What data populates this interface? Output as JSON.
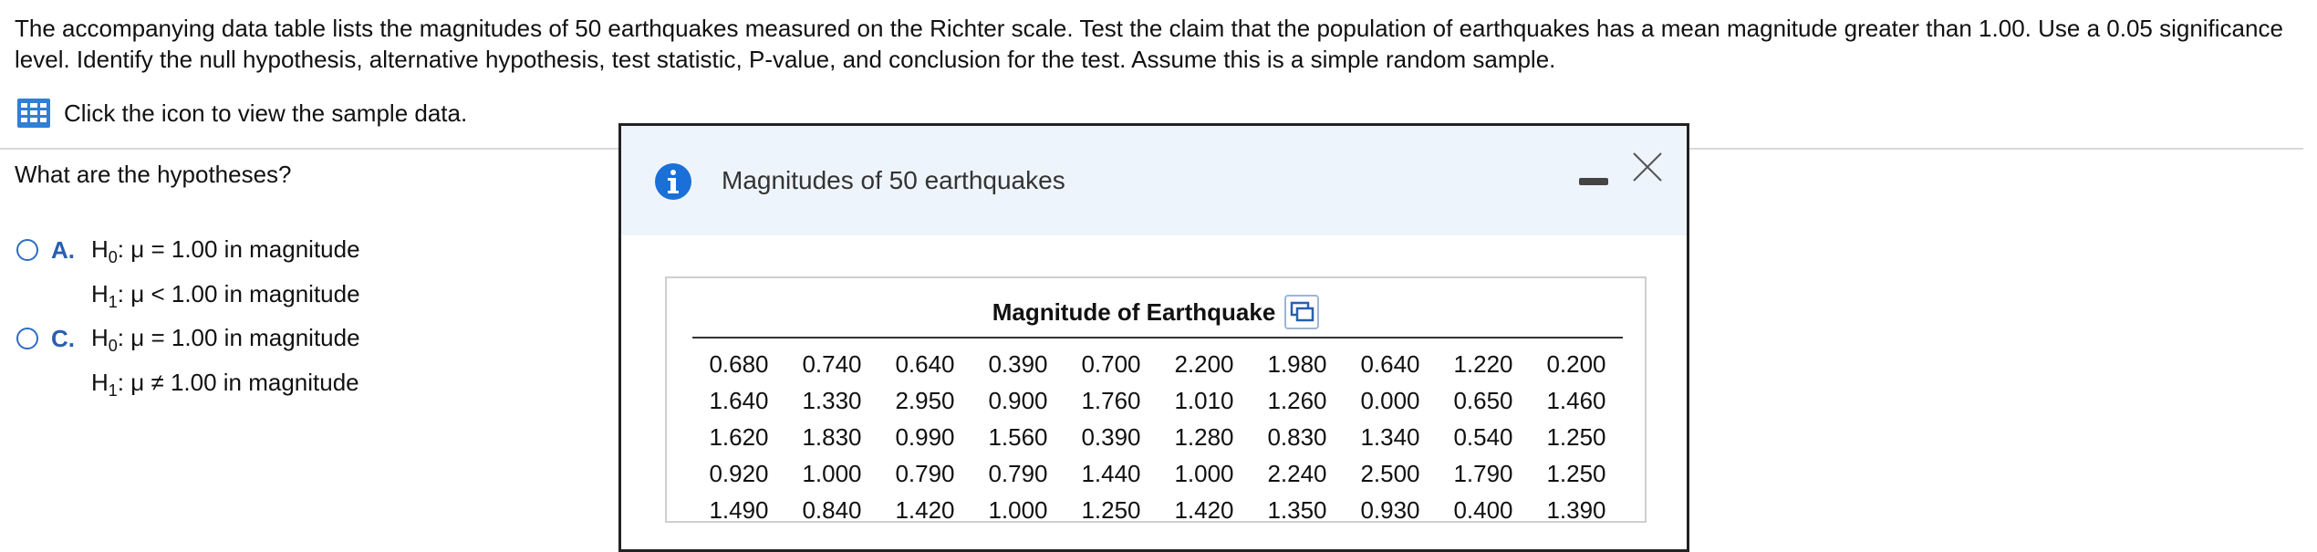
{
  "question": {
    "text": "The accompanying data table lists the magnitudes of 50 earthquakes measured on the Richter scale. Test the claim that the population of earthquakes has a mean magnitude greater than 1.00. Use a 0.05 significance level. Identify the null hypothesis, alternative hypothesis, test statistic, P-value, and conclusion for the test. Assume this is a simple random sample."
  },
  "data_link": {
    "label": "Click the icon to view the sample data.",
    "icon": "table-grid-icon"
  },
  "prompt": "What are the hypotheses?",
  "choices": [
    {
      "letter": "A.",
      "h0": {
        "label": "H",
        "sub": "0",
        "rest": ": μ = 1.00 in magnitude"
      },
      "h1": {
        "label": "H",
        "sub": "1",
        "rest": ": μ < 1.00 in magnitude"
      }
    },
    {
      "letter": "C.",
      "h0": {
        "label": "H",
        "sub": "0",
        "rest": ": μ = 1.00 in magnitude"
      },
      "h1": {
        "label": "H",
        "sub": "1",
        "rest": ": μ ≠ 1.00 in magnitude"
      }
    }
  ],
  "dialog": {
    "title": "Magnitudes of 50 earthquakes",
    "table_title": "Magnitude of Earthquake",
    "rows": [
      [
        "0.680",
        "0.740",
        "0.640",
        "0.390",
        "0.700",
        "2.200",
        "1.980",
        "0.640",
        "1.220",
        "0.200"
      ],
      [
        "1.640",
        "1.330",
        "2.950",
        "0.900",
        "1.760",
        "1.010",
        "1.260",
        "0.000",
        "0.650",
        "1.460"
      ],
      [
        "1.620",
        "1.830",
        "0.990",
        "1.560",
        "0.390",
        "1.280",
        "0.830",
        "1.340",
        "0.540",
        "1.250"
      ],
      [
        "0.920",
        "1.000",
        "0.790",
        "0.790",
        "1.440",
        "1.000",
        "2.240",
        "2.500",
        "1.790",
        "1.250"
      ],
      [
        "1.490",
        "0.840",
        "1.420",
        "1.000",
        "1.250",
        "1.420",
        "1.350",
        "0.930",
        "0.400",
        "1.390"
      ]
    ]
  },
  "colors": {
    "accent": "#2a5fb0",
    "info": "#1a6fd8",
    "dialog_header": "#eef4fb"
  }
}
